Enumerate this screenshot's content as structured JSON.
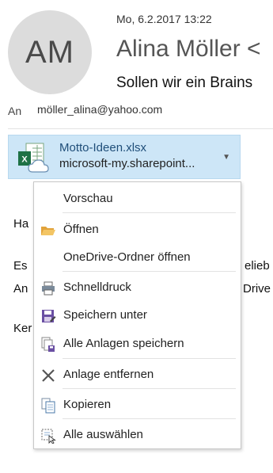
{
  "header": {
    "avatar_initials": "AM",
    "date": "Mo, 6.2.2017 13:22",
    "sender": "Alina Möller  <",
    "subject": "Sollen wir ein Brains",
    "to_label": "An",
    "to_value": "möller_alina@yahoo.com"
  },
  "attachment": {
    "name": "Motto-Ideen.xlsx",
    "location": "microsoft-my.sharepoint...",
    "icon": "excel-file-cloud-icon"
  },
  "body": {
    "line1": "Ha",
    "line2a": "Es",
    "line2b": "eliеb",
    "line3a": "An",
    "line3b": "Drive",
    "line4": "Ker"
  },
  "menu": {
    "items": [
      {
        "label": "Vorschau",
        "icon": ""
      },
      {
        "label": "Öffnen",
        "icon": "folder-open-icon"
      },
      {
        "label": "OneDrive-Ordner öffnen",
        "icon": ""
      },
      {
        "label": "Schnelldruck",
        "icon": "printer-icon"
      },
      {
        "label": "Speichern unter",
        "icon": "save-as-icon"
      },
      {
        "label": "Alle Anlagen speichern",
        "icon": "save-all-icon"
      },
      {
        "label": "Anlage entfernen",
        "icon": "remove-x-icon"
      },
      {
        "label": "Kopieren",
        "icon": "copy-icon"
      },
      {
        "label": "Alle auswählen",
        "icon": "select-all-icon"
      }
    ]
  },
  "colors": {
    "accent": "#cde6f7",
    "excel_green": "#1e7145"
  }
}
